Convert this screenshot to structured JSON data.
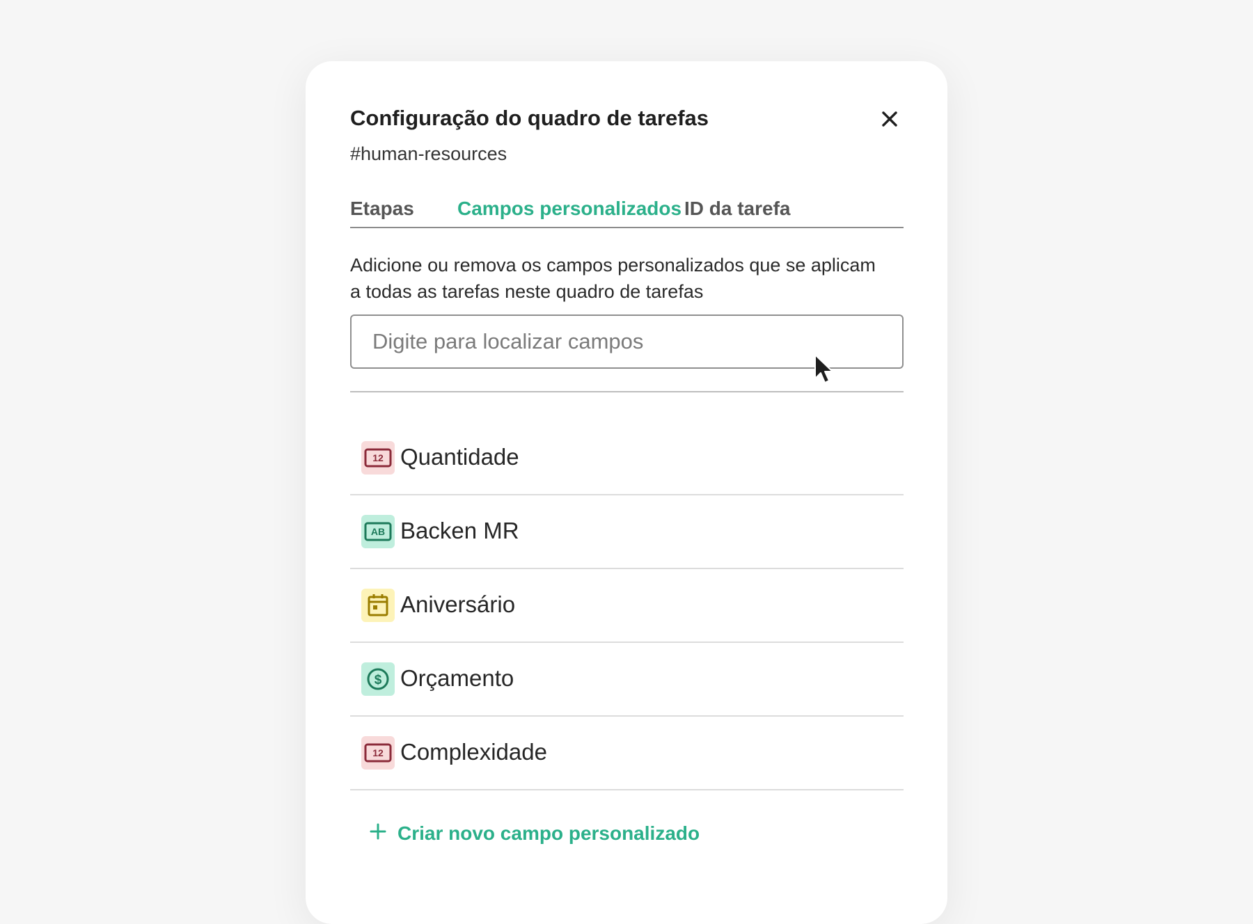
{
  "modal": {
    "title": "Configuração do quadro de tarefas",
    "subtitle": "#human-resources",
    "close_icon": "close-icon"
  },
  "tabs": [
    {
      "label": "Etapas",
      "active": false
    },
    {
      "label": "Campos personalizados",
      "active": true
    },
    {
      "label": "ID da tarefa",
      "active": false
    }
  ],
  "description": "Adicione ou remova os campos personalizados que se aplicam a todas as tarefas neste quadro de tarefas",
  "search": {
    "placeholder": "Digite para localizar campos",
    "value": ""
  },
  "fields": [
    {
      "label": "Quantidade",
      "icon": "number-field-icon",
      "icon_text": "12",
      "icon_bg": "#f8dada",
      "icon_color": "#8b2b3a"
    },
    {
      "label": "Backen MR",
      "icon": "text-field-icon",
      "icon_text": "AB",
      "icon_bg": "#bfeedd",
      "icon_color": "#1d7a5a"
    },
    {
      "label": "Aniversário",
      "icon": "calendar-icon",
      "icon_text": "",
      "icon_bg": "#fdf3b8",
      "icon_color": "#9a7d00"
    },
    {
      "label": "Orçamento",
      "icon": "currency-icon",
      "icon_text": "$",
      "icon_bg": "#bfeedd",
      "icon_color": "#1d7a5a"
    },
    {
      "label": "Complexidade",
      "icon": "number-field-icon",
      "icon_text": "12",
      "icon_bg": "#f8dada",
      "icon_color": "#8b2b3a"
    }
  ],
  "create": {
    "label": "Criar novo campo personalizado",
    "icon": "plus-icon"
  },
  "colors": {
    "accent": "#2bb08a",
    "text": "#1f1f1f"
  }
}
